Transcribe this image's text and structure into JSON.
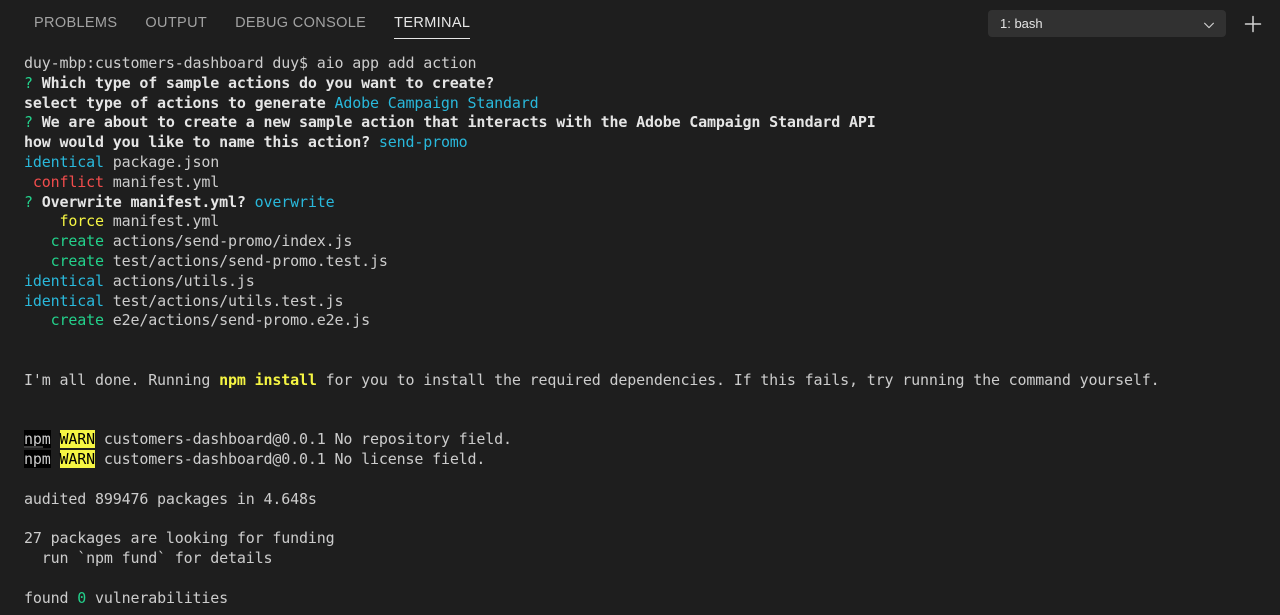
{
  "panel": {
    "tabs": [
      {
        "label": "PROBLEMS",
        "active": false
      },
      {
        "label": "OUTPUT",
        "active": false
      },
      {
        "label": "DEBUG CONSOLE",
        "active": false
      },
      {
        "label": "TERMINAL",
        "active": true
      }
    ],
    "terminal_selector": {
      "value": "1: bash",
      "icon": "chevron-down-icon"
    },
    "add_button": {
      "icon": "plus-icon",
      "label": "+"
    }
  },
  "terminal": {
    "lines": {
      "l01_prompt": "duy-mbp:customers-dashboard duy$ ",
      "l01_cmd": "aio app add action",
      "l02_q": "?",
      "l02_text": " Which type of sample actions do you want to create?",
      "l03_text": "select type of actions to generate ",
      "l03_answer": "Adobe Campaign Standard",
      "l04_q": "?",
      "l04_text": " We are about to create a new sample action that interacts with the Adobe Campaign Standard API",
      "l05_text": "how would you like to name this action? ",
      "l05_answer": "send-promo",
      "l06_status": "identical",
      "l06_file": " package.json",
      "l07_status": " conflict",
      "l07_file": " manifest.yml",
      "l08_q": "?",
      "l08_text": " Overwrite manifest.yml? ",
      "l08_answer": "overwrite",
      "l09_status": "    force",
      "l09_file": " manifest.yml",
      "l10_status": "   create",
      "l10_file": " actions/send-promo/index.js",
      "l11_status": "   create",
      "l11_file": " test/actions/send-promo.test.js",
      "l12_status": "identical",
      "l12_file": " actions/utils.js",
      "l13_status": "identical",
      "l13_file": " test/actions/utils.test.js",
      "l14_status": "   create",
      "l14_file": " e2e/actions/send-promo.e2e.js",
      "l15_a": "I'm all done. Running ",
      "l15_b": "npm install",
      "l15_c": " for you to install the required dependencies. If this fails, try running the command yourself.",
      "l16_npm": "npm",
      "l16_warn": "WARN",
      "l16_text": " customers-dashboard@0.0.1 No repository field.",
      "l17_npm": "npm",
      "l17_warn": "WARN",
      "l17_text": " customers-dashboard@0.0.1 No license field.",
      "l18_text": "audited 899476 packages in 4.648s",
      "l19_text": "27 packages are looking for funding",
      "l20_text": "  run `npm fund` for details",
      "l21_a": "found ",
      "l21_b": "0",
      "l21_c": " vulnerabilities"
    }
  },
  "colors": {
    "background": "#1e1e1e",
    "foreground": "#cccccc",
    "green": "#23d18b",
    "cyan": "#29b8db",
    "red": "#f14c4c",
    "yellow": "#f5f543",
    "select_bg": "#313131"
  }
}
